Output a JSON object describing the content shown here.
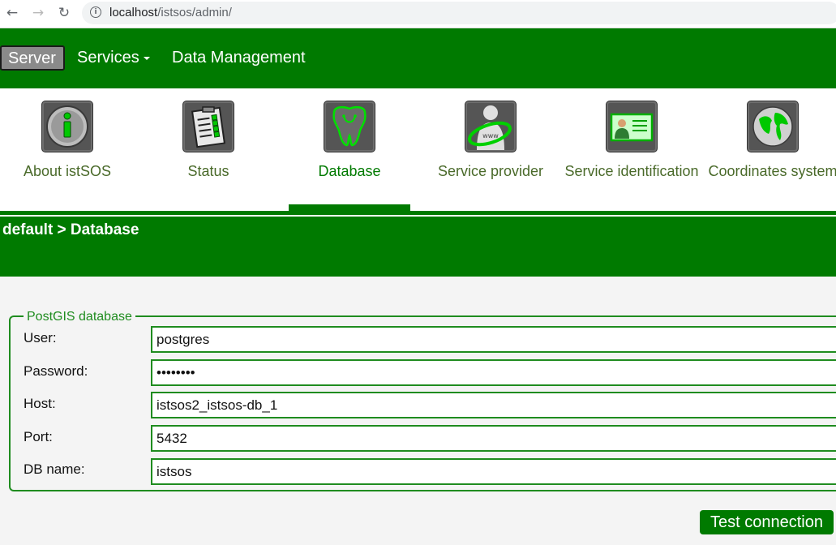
{
  "browser": {
    "url_host": "localhost",
    "url_path": "/istsos/admin/"
  },
  "topnav": {
    "server": "Server",
    "services": "Services",
    "data_management": "Data Management"
  },
  "tools": [
    {
      "label": "About istSOS",
      "icon": "info-icon"
    },
    {
      "label": "Status",
      "icon": "clipboard-icon"
    },
    {
      "label": "Database",
      "icon": "postgres-elephant-icon",
      "active": true
    },
    {
      "label": "Service provider",
      "icon": "person-globe-icon"
    },
    {
      "label": "Service identification",
      "icon": "id-card-icon"
    },
    {
      "label": "Coordinates system",
      "icon": "globe-icon"
    }
  ],
  "breadcrumb": "default > Database",
  "form": {
    "legend": "PostGIS database",
    "user_label": "User:",
    "user_value": "postgres",
    "password_label": "Password:",
    "password_value": "password",
    "host_label": "Host:",
    "host_value": "istsos2_istsos-db_1",
    "port_label": "Port:",
    "port_value": "5432",
    "dbname_label": "DB name:",
    "dbname_value": "istsos"
  },
  "test_button": "Test connection",
  "colors": {
    "brand_green": "#007a00",
    "border_green": "#1f8c1f"
  }
}
